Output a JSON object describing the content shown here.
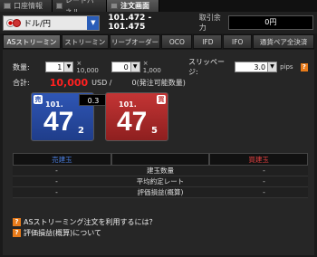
{
  "window_tabs": [
    {
      "label": "口座情報"
    },
    {
      "label": "レートパネル"
    },
    {
      "label": "注文画面"
    }
  ],
  "toolbar": {
    "pair": "ドル/円",
    "bid_ask": "101.472 - 101.475",
    "margin_label": "取引余力",
    "margin_value": "0円"
  },
  "order_tabs": [
    {
      "label": "ASストリーミング"
    },
    {
      "label": "ストリーミング"
    },
    {
      "label": "リーブオーダー"
    },
    {
      "label": "OCO"
    },
    {
      "label": "IFD"
    },
    {
      "label": "IFO"
    },
    {
      "label": "通貨ペア全決済"
    }
  ],
  "form": {
    "qty_label": "数量:",
    "qty_value": "1",
    "qty_mult": "× 10,000",
    "qty2_value": "0",
    "qty2_mult": "× 1,000",
    "slippage_label": "スリッページ:",
    "slippage_value": "3.0",
    "slippage_unit": "pips",
    "total_label": "合計:",
    "total_value": "10,000",
    "total_unit": "USD /",
    "available": "0(発注可能数量)"
  },
  "quote": {
    "sell_tag": "売",
    "sell_big": "101.",
    "sell_pip": "47",
    "sell_frac": "2",
    "buy_tag": "買",
    "buy_big": "101.",
    "buy_pip": "47",
    "buy_frac": "5",
    "spread": "0.3"
  },
  "position": {
    "sell_header": "売建玉",
    "buy_header": "買建玉",
    "rows": [
      {
        "left": "-",
        "label": "建玉数量",
        "right": "-"
      },
      {
        "left": "-",
        "label": "平均約定レート",
        "right": "-"
      },
      {
        "left": "-",
        "label": "評価損益(概算)",
        "right": "-"
      }
    ]
  },
  "links": [
    {
      "label": "ASストリーミング注文を利用するには？"
    },
    {
      "label": "評価損益(概算)について"
    }
  ],
  "colors": {
    "sell": "#2f56b5",
    "buy": "#c43535",
    "total": "#ff2020",
    "help": "#e87b1a"
  }
}
